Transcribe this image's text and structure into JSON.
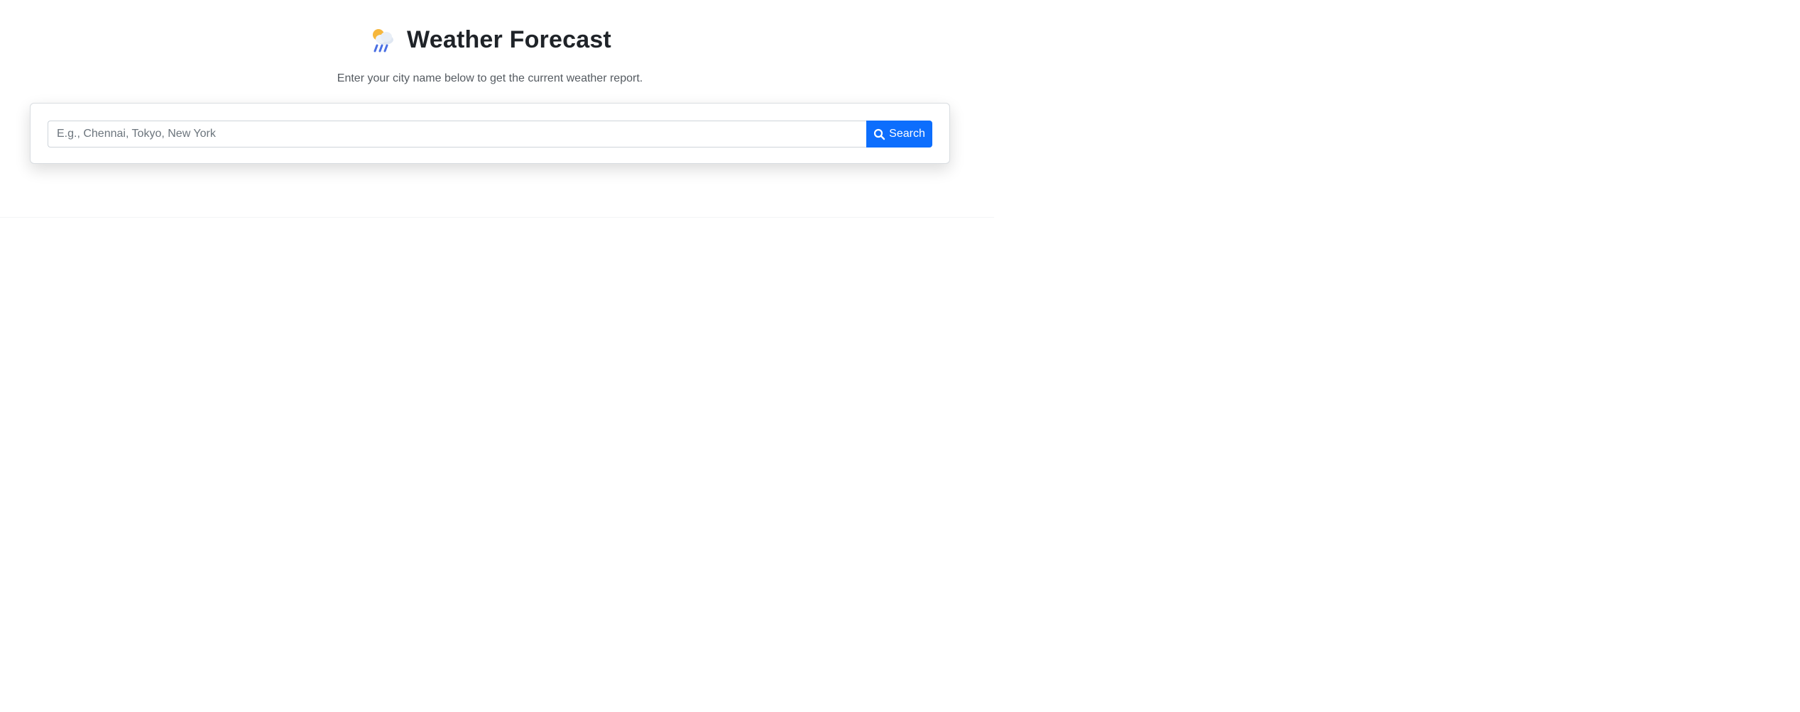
{
  "header": {
    "title": "Weather Forecast",
    "subtitle": "Enter your city name below to get the current weather report.",
    "icon": "sun-behind-rain-cloud-icon"
  },
  "search": {
    "placeholder": "E.g., Chennai, Tokyo, New York",
    "value": "",
    "button_label": "Search",
    "button_icon": "search-icon"
  },
  "colors": {
    "accent": "#0d6efd",
    "title": "#1f2328",
    "subtitle": "#555b61",
    "placeholder": "#6c757d"
  }
}
